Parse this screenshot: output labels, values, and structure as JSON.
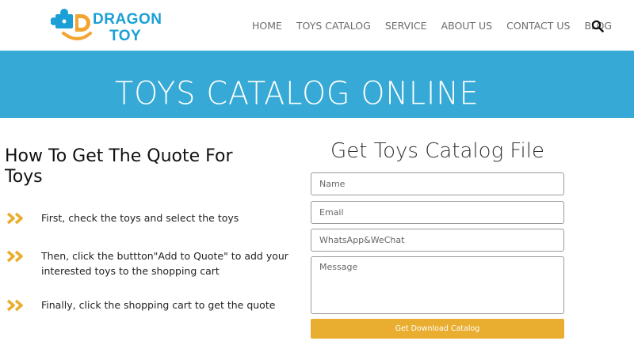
{
  "brand": {
    "line1": "DRAGON",
    "line2": "TOY",
    "colors": {
      "blue": "#1aa0d6",
      "orange": "#f2a531"
    }
  },
  "nav": {
    "items": [
      {
        "label": "HOME"
      },
      {
        "label": "TOYS CATALOG"
      },
      {
        "label": "SERVICE"
      },
      {
        "label": "ABOUT US"
      },
      {
        "label": "CONTACT US"
      },
      {
        "label": "BLOG"
      }
    ],
    "search_icon": "search-icon"
  },
  "banner": {
    "title": "TOYS CATALOG ONLINE",
    "color": "#36a9d6"
  },
  "quote": {
    "heading": "How To Get The Quote For Toys",
    "bullet_icon": "double-chevron-right-icon",
    "bullet_color": "#e9ad2f",
    "steps": [
      {
        "text": "First, check the toys and select the toys"
      },
      {
        "text": "Then, click the buttton\"Add to Quote\" to add your interested toys to the shopping cart"
      },
      {
        "text": "Finally, click the shopping cart to get the quote"
      }
    ]
  },
  "form": {
    "title": "Get Toys Catalog File",
    "name_placeholder": "Name",
    "email_placeholder": "Email",
    "whatsapp_placeholder": "WhatsApp&WeChat",
    "message_placeholder": "Message",
    "submit_label": "Get Download Catalog",
    "submit_color": "#e9ad2f"
  }
}
